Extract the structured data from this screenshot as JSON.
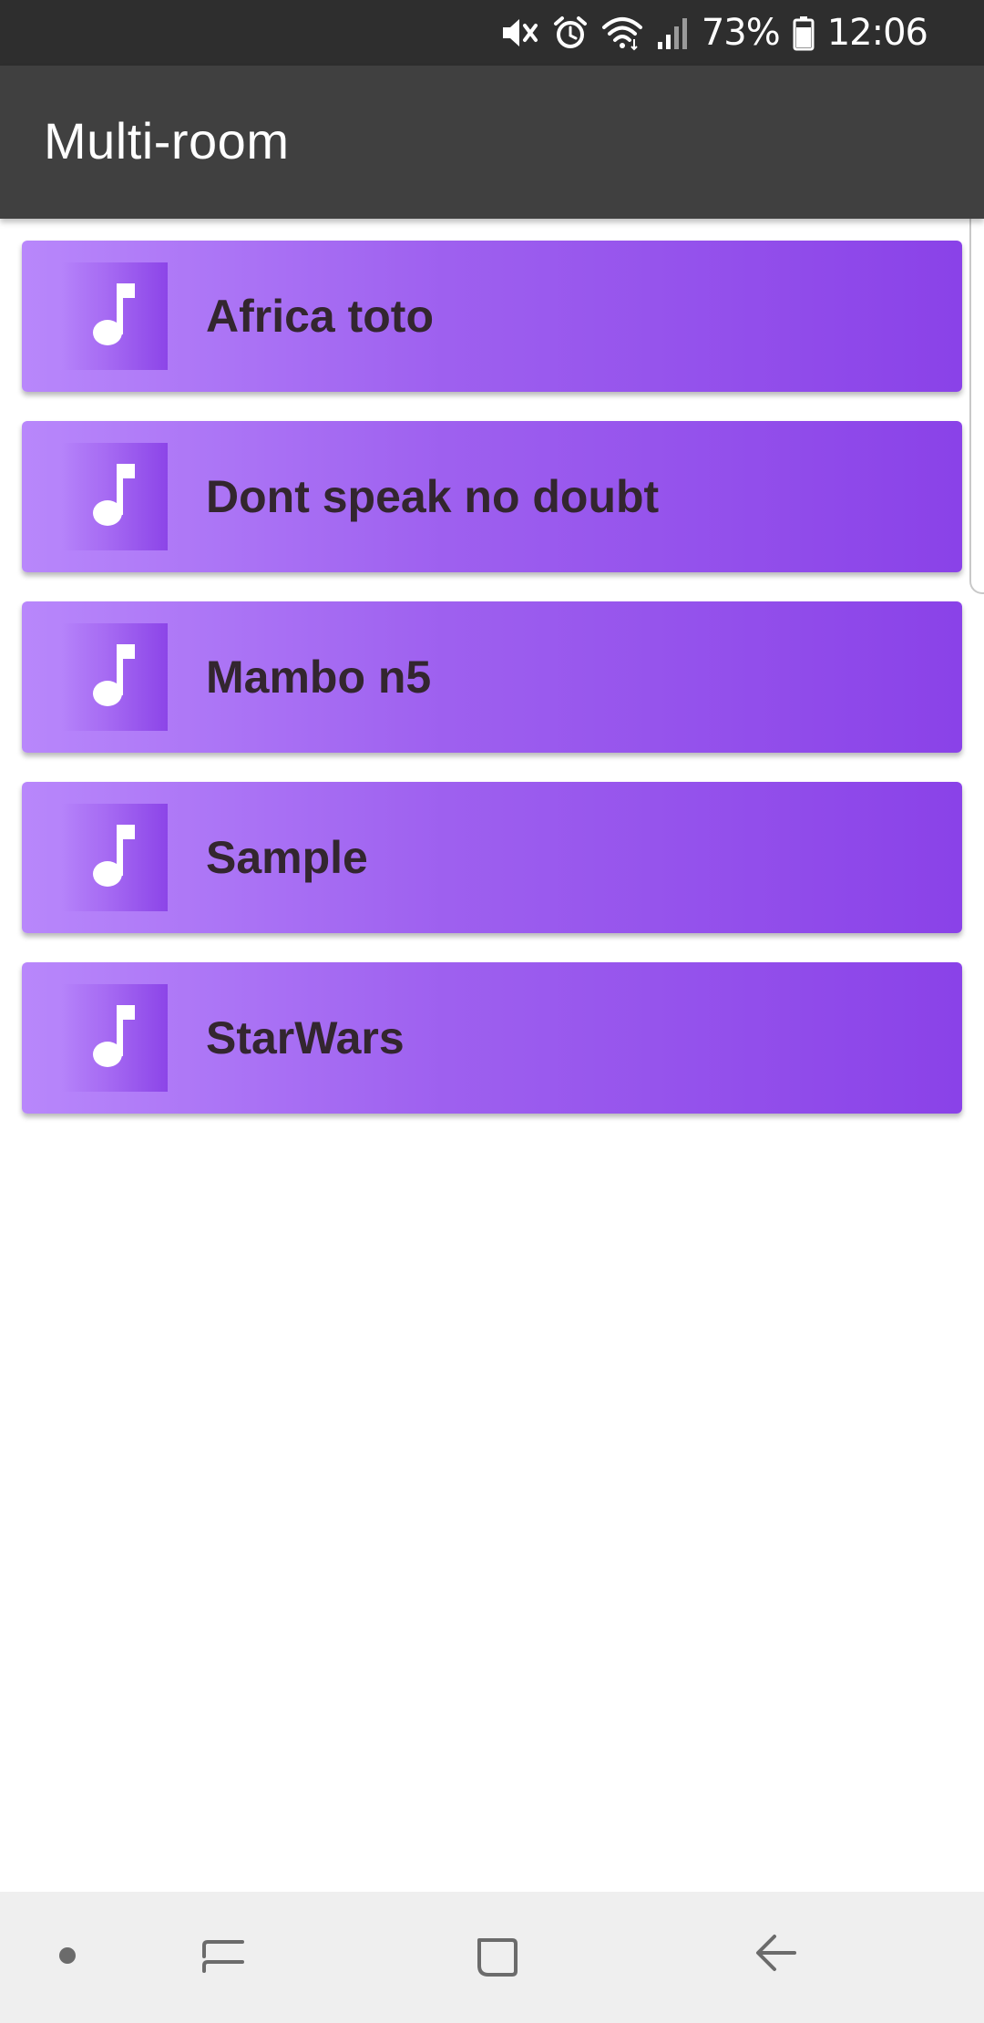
{
  "status_bar": {
    "battery_percent": "73%",
    "time": "12:06",
    "icons": [
      "mute-icon",
      "alarm-icon",
      "wifi-icon",
      "signal-icon",
      "battery-icon"
    ]
  },
  "app_bar": {
    "title": "Multi-room"
  },
  "songs": [
    {
      "title": "Africa toto",
      "icon": "music-note-icon"
    },
    {
      "title": "Dont speak no doubt",
      "icon": "music-note-icon"
    },
    {
      "title": "Mambo n5",
      "icon": "music-note-icon"
    },
    {
      "title": "Sample",
      "icon": "music-note-icon"
    },
    {
      "title": "StarWars",
      "icon": "music-note-icon"
    }
  ],
  "nav_bar": {
    "buttons": [
      "assistant-dot-icon",
      "recents-icon",
      "home-icon",
      "back-icon"
    ]
  },
  "colors": {
    "status_bar": "#2e2e2e",
    "app_bar": "#404040",
    "card_gradient_start": "#b887fb",
    "card_gradient_end": "#8a42e8",
    "song_text": "#33262f",
    "nav_bar": "#efefef"
  }
}
